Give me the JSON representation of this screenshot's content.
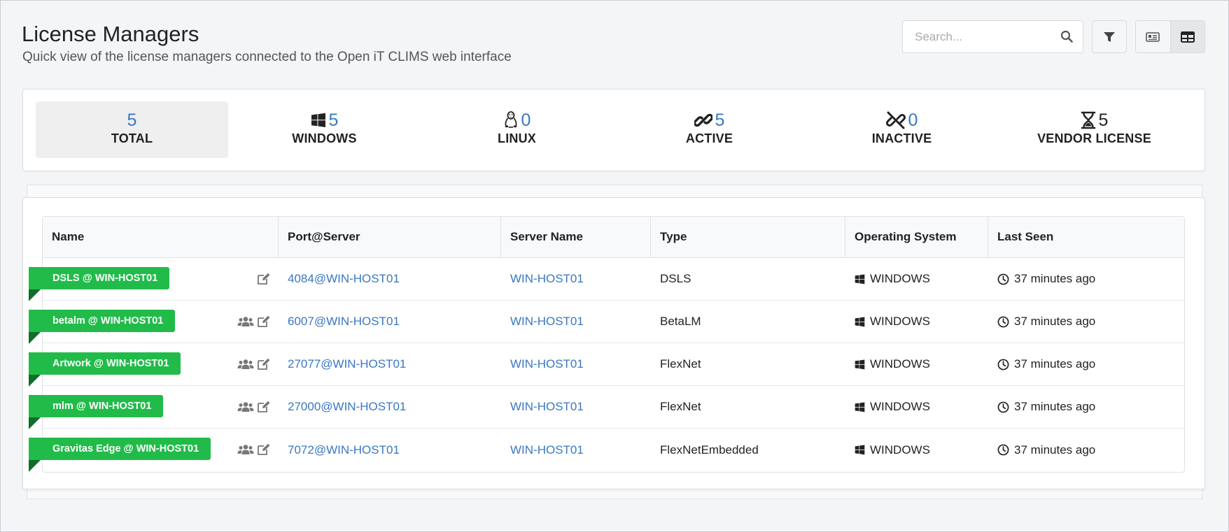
{
  "header": {
    "title": "License Managers",
    "subtitle": "Quick view of the license managers connected to the Open iT CLIMS web interface"
  },
  "toolbar": {
    "search_placeholder": "Search...",
    "search_icon": "search-icon",
    "filter_icon": "filter-icon",
    "view_card_icon": "card-view-icon",
    "view_table_icon": "table-view-icon"
  },
  "summary": {
    "total": {
      "count": "5",
      "label": "TOTAL"
    },
    "windows": {
      "count": "5",
      "label": "WINDOWS",
      "icon": "windows-icon"
    },
    "linux": {
      "count": "0",
      "label": "LINUX",
      "icon": "linux-icon"
    },
    "active": {
      "count": "5",
      "label": "ACTIVE",
      "icon": "link-icon"
    },
    "inactive": {
      "count": "0",
      "label": "INACTIVE",
      "icon": "unlink-icon"
    },
    "vendor": {
      "count": "5",
      "label": "VENDOR LICENSE",
      "icon": "hourglass-icon"
    }
  },
  "colors": {
    "accent_blue": "#3a77c2",
    "ribbon_green": "#21bb4a"
  },
  "table": {
    "columns": [
      "Name",
      "Port@Server",
      "Server Name",
      "Type",
      "Operating System",
      "Last Seen"
    ],
    "rows": [
      {
        "name": "DSLS @ WIN-HOST01",
        "port_server": "4084@WIN-HOST01",
        "server_name": "WIN-HOST01",
        "type": "DSLS",
        "os": "WINDOWS",
        "last_seen": "37 minutes ago"
      },
      {
        "name": "betalm @ WIN-HOST01",
        "port_server": "6007@WIN-HOST01",
        "server_name": "WIN-HOST01",
        "type": "BetaLM",
        "os": "WINDOWS",
        "last_seen": "37 minutes ago"
      },
      {
        "name": "Artwork @ WIN-HOST01",
        "port_server": "27077@WIN-HOST01",
        "server_name": "WIN-HOST01",
        "type": "FlexNet",
        "os": "WINDOWS",
        "last_seen": "37 minutes ago"
      },
      {
        "name": "mlm @ WIN-HOST01",
        "port_server": "27000@WIN-HOST01",
        "server_name": "WIN-HOST01",
        "type": "FlexNet",
        "os": "WINDOWS",
        "last_seen": "37 minutes ago"
      },
      {
        "name": "Gravitas Edge @ WIN-HOST01",
        "port_server": "7072@WIN-HOST01",
        "server_name": "WIN-HOST01",
        "type": "FlexNetEmbedded",
        "os": "WINDOWS",
        "last_seen": "37 minutes ago"
      }
    ]
  }
}
